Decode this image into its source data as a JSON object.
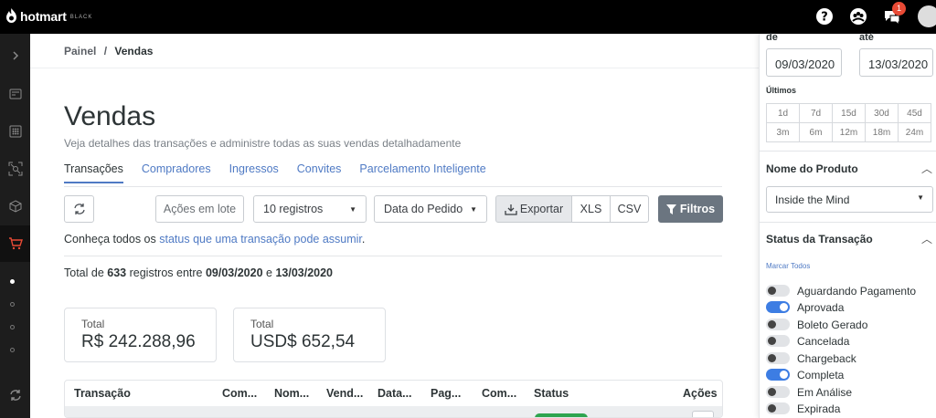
{
  "header": {
    "brand": "hotmart",
    "brand_suffix": "BLACK",
    "notification_count": "1",
    "icons": [
      "help-icon",
      "community-icon",
      "chat-icon",
      "avatar"
    ]
  },
  "sidebar": {
    "icons": [
      "expand-icon",
      "dashboard-icon",
      "apps-icon",
      "network-icon",
      "product-box-icon",
      "cart-icon",
      "sync-icon"
    ]
  },
  "breadcrumb": {
    "root": "Painel",
    "sep": "/",
    "current": "Vendas"
  },
  "page": {
    "title": "Vendas",
    "subtitle": "Veja detalhes das transações e administre todas as suas vendas detalhadamente"
  },
  "tabs": [
    "Transações",
    "Compradores",
    "Ingressos",
    "Convites",
    "Parcelamento Inteligente"
  ],
  "toolbar": {
    "bulk_actions": "Ações em lote",
    "page_size": "10 registros",
    "date_type": "Data do Pedido",
    "export": "Exportar",
    "xls": "XLS",
    "csv": "CSV",
    "filters": "Filtros"
  },
  "info": {
    "prefix": "Conheça todos os ",
    "link": "status que uma transação pode assumir",
    "suffix": "."
  },
  "summary": {
    "p1": "Total de ",
    "count": "633",
    "p2": " registros entre ",
    "start": "09/03/2020",
    "p3": " e ",
    "end": "13/03/2020"
  },
  "cards": [
    {
      "label": "Total",
      "value": "R$ 242.288,96"
    },
    {
      "label": "Total",
      "value": "USD$ 652,54"
    }
  ],
  "table": {
    "headers": [
      "Transação",
      "Com...",
      "Nom...",
      "Vend...",
      "Data...",
      "Pag...",
      "Com...",
      "Status",
      "Ações"
    ]
  },
  "panel": {
    "from_label": "de",
    "to_label": "até",
    "from_date": "09/03/2020",
    "to_date": "13/03/2020",
    "recent_label": "Últimos",
    "ranges": [
      "1d",
      "7d",
      "15d",
      "30d",
      "45d",
      "3m",
      "6m",
      "12m",
      "18m",
      "24m"
    ],
    "product_section": "Nome do Produto",
    "product_value": "Inside the Mind",
    "status_section": "Status da Transação",
    "mark_all": "Marcar Todos",
    "statuses": [
      {
        "label": "Aguardando Pagamento",
        "on": false
      },
      {
        "label": "Aprovada",
        "on": true
      },
      {
        "label": "Boleto Gerado",
        "on": false
      },
      {
        "label": "Cancelada",
        "on": false
      },
      {
        "label": "Chargeback",
        "on": false
      },
      {
        "label": "Completa",
        "on": true
      },
      {
        "label": "Em Análise",
        "on": false
      },
      {
        "label": "Expirada",
        "on": false
      }
    ]
  },
  "colors": {
    "accent": "#4f7ac4",
    "toggle_on": "#3d7de3",
    "success": "#2ea44f",
    "topbar": "#000000"
  }
}
